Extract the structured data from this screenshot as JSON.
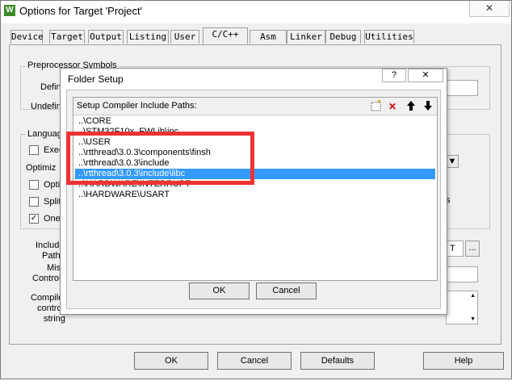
{
  "window": {
    "title": "Options for Target 'Project'",
    "icon_letter": "W",
    "close_symbol": "✕"
  },
  "tabs": [
    {
      "label": "Device"
    },
    {
      "label": "Target"
    },
    {
      "label": "Output"
    },
    {
      "label": "Listing"
    },
    {
      "label": "User"
    },
    {
      "label": "C/C++"
    },
    {
      "label": "Asm"
    },
    {
      "label": "Linker"
    },
    {
      "label": "Debug"
    },
    {
      "label": "Utilities"
    }
  ],
  "active_tab": "C/C++",
  "panel": {
    "preprocessor_group": "Preprocessor Symbols",
    "define_label": "Defin",
    "undefine_label": "Undefin",
    "language_group": "Languag",
    "exec_label": "Exec",
    "optimization_label": "Optimiz",
    "opti_label": "Optin",
    "split_label": "Split",
    "one_label": "One",
    "one_checked": true,
    "include_paths_label": [
      "Include",
      "Paths"
    ],
    "misc_label": [
      "Misc",
      "Controls"
    ],
    "compiler_label": [
      "Compiler",
      "control",
      "string"
    ],
    "include_value_tail": "T",
    "browse_label": "...",
    "side_fragment": "s"
  },
  "dialog": {
    "title": "Folder Setup",
    "help_symbol": "?",
    "close_symbol": "✕",
    "list_header": "Setup Compiler Include Paths:",
    "toolbar_icons": [
      "new-folder-icon",
      "delete-icon",
      "move-up-icon",
      "move-down-icon"
    ],
    "paths": [
      "..\\CORE",
      "..\\STM32F10x_FWLib\\inc",
      "..\\USER",
      "..\\rtthread\\3.0.3\\components\\finsh",
      "..\\rtthread\\3.0.3\\include",
      "..\\rtthread\\3.0.3\\include\\libc",
      "..\\HARDWARE\\INTERRUPT",
      "..\\HARDWARE\\USART"
    ],
    "selected_index": 5,
    "ok_label": "OK",
    "cancel_label": "Cancel",
    "highlight_color": "#ee3333",
    "selection_color": "#3399ff"
  },
  "footer": {
    "ok_label": "OK",
    "cancel_label": "Cancel",
    "defaults_label": "Defaults",
    "help_label": "Help"
  }
}
